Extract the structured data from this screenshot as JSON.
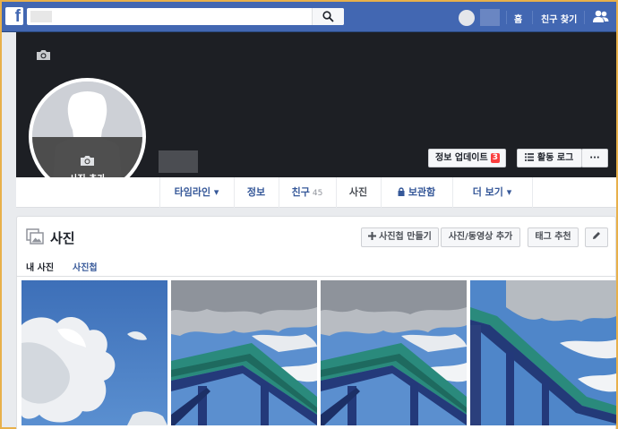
{
  "topbar": {
    "logo": "f",
    "search_placeholder": "",
    "home_label": "홈",
    "find_friends_label": "친구 찾기",
    "icons": [
      "search-icon",
      "friend-requests-icon"
    ]
  },
  "cover": {
    "profile_add_photo_label": "사진 추가",
    "update_info_label": "정보 업데이트",
    "update_info_count": "3",
    "activity_log_label": "활동 로그",
    "more_label": "···"
  },
  "tabs": [
    {
      "label": "타임라인 ▾"
    },
    {
      "label": "정보"
    },
    {
      "label": "친구",
      "count": "45"
    },
    {
      "label": "사진"
    },
    {
      "label": "보관함"
    },
    {
      "label": "더 보기 ▾"
    }
  ],
  "photos": {
    "title": "사진",
    "create_album_label": "사진첩 만들기",
    "add_media_label": "사진/동영상 추가",
    "tag_suggest_label": "태그 추천",
    "subtabs": [
      "내 사진",
      "사진첩"
    ]
  },
  "colors": {
    "brand": "#4267b2",
    "link": "#365899",
    "badge": "#fa3e3e",
    "cover": "#1d1f24"
  }
}
